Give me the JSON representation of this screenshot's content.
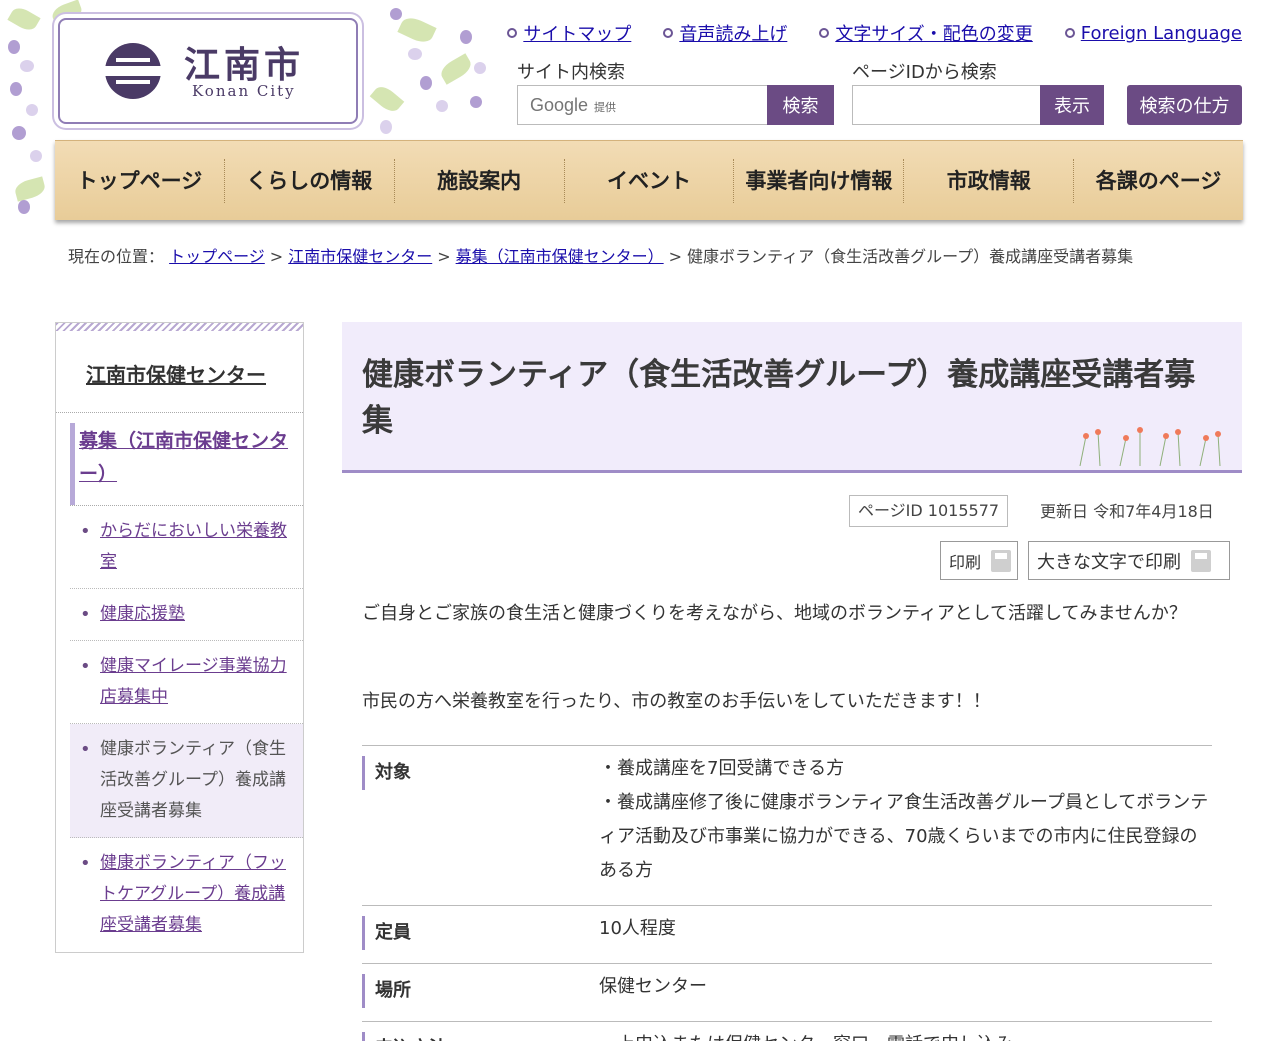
{
  "header": {
    "logo_name": "江南市",
    "logo_sub": "Konan City",
    "util_links": [
      "サイトマップ",
      "音声読み上げ",
      "文字サイズ・配色の変更",
      "Foreign Language"
    ],
    "site_search_label": "サイト内検索",
    "google_label": "Google",
    "google_sub": "提供",
    "search_button": "検索",
    "pageid_label": "ページIDから検索",
    "pageid_button": "表示",
    "howto_button": "検索の仕方"
  },
  "nav": [
    "トップページ",
    "くらしの情報",
    "施設案内",
    "イベント",
    "事業者向け情報",
    "市政情報",
    "各課のページ"
  ],
  "breadcrumb": {
    "prefix": "現在の位置：",
    "links": [
      "トップページ",
      "江南市保健センター",
      "募集（江南市保健センター）"
    ],
    "current": "健康ボランティア（食生活改善グループ）養成講座受講者募集"
  },
  "sidebar": {
    "heading": "江南市保健センター",
    "current_section": "募集（江南市保健センター）",
    "items": [
      "からだにおいしい栄養教室",
      "健康応援塾",
      "健康マイレージ事業協力店募集中",
      "健康ボランティア（食生活改善グループ）養成講座受講者募集",
      "健康ボランティア（フットケアグループ）養成講座受講者募集"
    ]
  },
  "main": {
    "title": "健康ボランティア（食生活改善グループ）養成講座受講者募集",
    "page_id": "ページID 1015577",
    "updated": "更新日 令和7年4月18日",
    "print_label": "印刷",
    "print_large_label": "大きな文字で印刷",
    "intro1": "ご自身とご家族の食生活と健康づくりを考えながら、地域のボランティアとして活躍してみませんか？",
    "intro2": "市民の方へ栄養教室を行ったり、市の教室のお手伝いをしていただきます！！",
    "info": [
      {
        "label": "対象",
        "value": "・養成講座を7回受講できる方\n・養成講座修了後に健康ボランティア食生活改善グループ員としてボランティア活動及び市事業に協力ができる、70歳くらいまでの市内に住民登録のある方"
      },
      {
        "label": "定員",
        "value": "10人程度"
      },
      {
        "label": "場所",
        "value": "保健センター"
      },
      {
        "label": "申込方法",
        "value": "・上申込または保健センター窓口、電話で申し込み"
      }
    ]
  },
  "colors": {
    "accent": "#6b4b84",
    "title_bg": "#f1ecfb",
    "nav_bg": "#eed7aa",
    "link": "#1a0dab"
  }
}
